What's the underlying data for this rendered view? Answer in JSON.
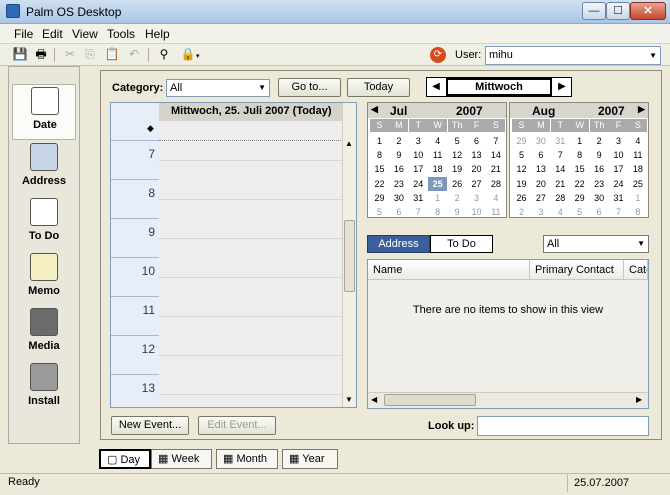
{
  "window": {
    "title": "Palm OS Desktop",
    "min": "—",
    "max": "☐",
    "close": "✕"
  },
  "menu": [
    "File",
    "Edit",
    "View",
    "Tools",
    "Help"
  ],
  "toolbar": {
    "user_label": "User:",
    "user_value": "mihu"
  },
  "apps": [
    "Date",
    "Address",
    "To Do",
    "Memo",
    "Media",
    "Install"
  ],
  "controls": {
    "category_label": "Category:",
    "category_value": "All",
    "goto_label": "Go to...",
    "today_label": "Today",
    "nav_day": "Mittwoch"
  },
  "day_header": "Mittwoch, 25. Juli 2007 (Today)",
  "hours": [
    "7",
    "8",
    "9",
    "10",
    "11",
    "12",
    "13"
  ],
  "calendars": [
    {
      "month": "Jul",
      "year": "2007",
      "dow": [
        "S",
        "M",
        "T",
        "W",
        "Th",
        "F",
        "S"
      ],
      "weeks": [
        [
          "1",
          "2",
          "3",
          "4",
          "5",
          "6",
          "7"
        ],
        [
          "8",
          "9",
          "10",
          "11",
          "12",
          "13",
          "14"
        ],
        [
          "15",
          "16",
          "17",
          "18",
          "19",
          "20",
          "21"
        ],
        [
          "22",
          "23",
          "24",
          "25",
          "26",
          "27",
          "28"
        ],
        [
          "29",
          "30",
          "31",
          "1",
          "2",
          "3",
          "4"
        ],
        [
          "5",
          "6",
          "7",
          "8",
          "9",
          "10",
          "11"
        ]
      ],
      "today": "25",
      "dim_from_row": 4,
      "dim_from_col": 3
    },
    {
      "month": "Aug",
      "year": "2007",
      "dow": [
        "S",
        "M",
        "T",
        "W",
        "Th",
        "F",
        "S"
      ],
      "weeks": [
        [
          "29",
          "30",
          "31",
          "1",
          "2",
          "3",
          "4"
        ],
        [
          "5",
          "6",
          "7",
          "8",
          "9",
          "10",
          "11"
        ],
        [
          "12",
          "13",
          "14",
          "15",
          "16",
          "17",
          "18"
        ],
        [
          "19",
          "20",
          "21",
          "22",
          "23",
          "24",
          "25"
        ],
        [
          "26",
          "27",
          "28",
          "29",
          "30",
          "31",
          "1"
        ],
        [
          "2",
          "3",
          "4",
          "5",
          "6",
          "7",
          "8"
        ]
      ],
      "dim_lead": 3,
      "dim_from_row": 4,
      "dim_from_col": 6
    }
  ],
  "tabs": {
    "address": "Address",
    "todo": "To Do",
    "filter": "All"
  },
  "list": {
    "columns": [
      "Name",
      "Primary Contact",
      "Cate"
    ],
    "empty_text": "There are no items to show in this view"
  },
  "buttons": {
    "new_event": "New Event...",
    "edit_event": "Edit Event...",
    "lookup": "Look up:"
  },
  "views": [
    "Day",
    "Week",
    "Month",
    "Year"
  ],
  "status": {
    "text": "Ready",
    "date": "25.07.2007"
  }
}
